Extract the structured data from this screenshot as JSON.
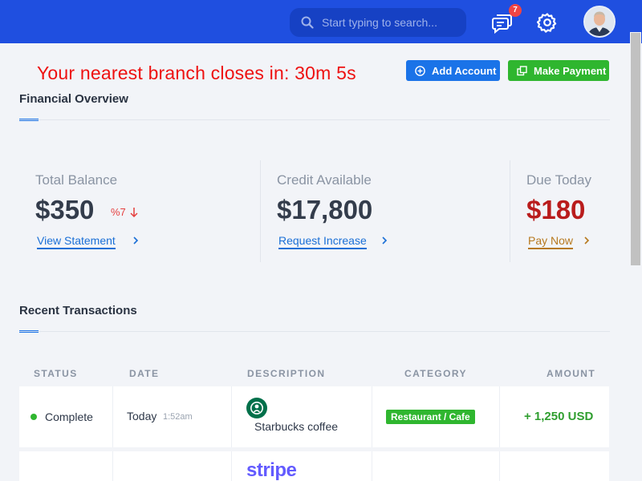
{
  "topbar": {
    "search_placeholder": "Start typing to search...",
    "notifications_count": "7",
    "icons": [
      "search-icon",
      "chat-icon",
      "gear-icon",
      "user-avatar"
    ],
    "colors": {
      "bar": "#1f4fe0",
      "search_bg": "#1641c4",
      "badge": "#ef4444"
    }
  },
  "banner": {
    "countdown_text": "Your nearest branch closes in: 30m 5s",
    "countdown_color": "#ee1111"
  },
  "actions": {
    "add_account_label": "Add Account",
    "make_payment_label": "Make Payment",
    "colors": {
      "add": "#1a73e8",
      "pay": "#2fb62f"
    }
  },
  "overview": {
    "title": "Financial Overview",
    "cards": [
      {
        "label": "Total Balance",
        "value": "$350",
        "change": "%7",
        "change_direction": "down",
        "link": "View Statement"
      },
      {
        "label": "Credit Available",
        "value": "$17,800",
        "link": "Request Increase"
      },
      {
        "label": "Due Today",
        "value": "$180",
        "link": "Pay Now"
      }
    ]
  },
  "transactions": {
    "title": "Recent Transactions",
    "columns": [
      "STATUS",
      "DATE",
      "DESCRIPTION",
      "CATEGORY",
      "AMOUNT"
    ],
    "rows": [
      {
        "status": "Complete",
        "date": "Today",
        "time": "1:52am",
        "logo": "starbucks-logo",
        "description": "Starbucks coffee",
        "category": "Restaurant / Cafe",
        "amount": "+ 1,250 USD"
      },
      {
        "logo": "stripe-logo",
        "logo_text": "stripe"
      }
    ]
  }
}
